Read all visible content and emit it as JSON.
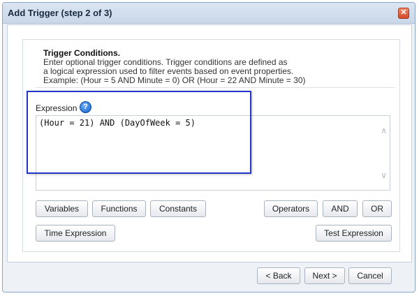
{
  "dialog": {
    "title": "Add Trigger (step 2 of 3)",
    "close_glyph": "✕"
  },
  "instructions": {
    "heading": "Trigger Conditions.",
    "line1": "Enter optional trigger conditions. Trigger conditions are defined as",
    "line2": "a logical expression used to filter events based on event properties.",
    "line3": "Example: (Hour = 5 AND Minute = 0) OR (Hour = 22 AND Minute = 30)"
  },
  "expression": {
    "label": "Expression",
    "help_glyph": "?",
    "value": "(Hour = 21) AND (DayOfWeek = 5)"
  },
  "buttons": {
    "variables": "Variables",
    "functions": "Functions",
    "constants": "Constants",
    "operators": "Operators",
    "and": "AND",
    "or": "OR",
    "time_expression": "Time Expression",
    "test_expression": "Test Expression"
  },
  "footer": {
    "back": "< Back",
    "next": "Next >",
    "cancel": "Cancel"
  },
  "icons": {
    "help": "help-icon",
    "close": "close-icon",
    "scroll_up": "chevron-up-icon",
    "scroll_down": "chevron-down-icon"
  },
  "colors": {
    "highlight": "#2436c8",
    "title_bar": "#c9d7e9"
  }
}
